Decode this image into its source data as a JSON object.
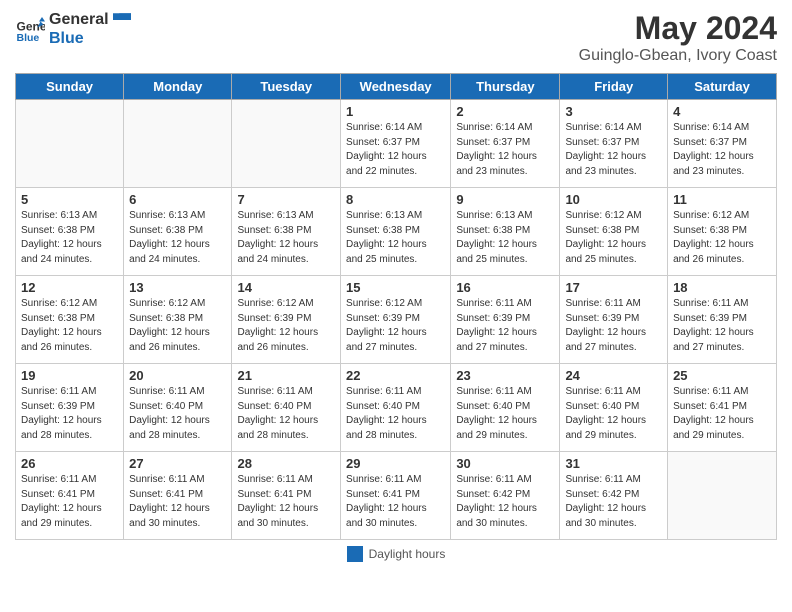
{
  "header": {
    "logo_line1": "General",
    "logo_line2": "Blue",
    "title": "May 2024",
    "subtitle": "Guinglo-Gbean, Ivory Coast"
  },
  "weekdays": [
    "Sunday",
    "Monday",
    "Tuesday",
    "Wednesday",
    "Thursday",
    "Friday",
    "Saturday"
  ],
  "weeks": [
    [
      {
        "day": "",
        "info": ""
      },
      {
        "day": "",
        "info": ""
      },
      {
        "day": "",
        "info": ""
      },
      {
        "day": "1",
        "info": "Sunrise: 6:14 AM\nSunset: 6:37 PM\nDaylight: 12 hours\nand 22 minutes."
      },
      {
        "day": "2",
        "info": "Sunrise: 6:14 AM\nSunset: 6:37 PM\nDaylight: 12 hours\nand 23 minutes."
      },
      {
        "day": "3",
        "info": "Sunrise: 6:14 AM\nSunset: 6:37 PM\nDaylight: 12 hours\nand 23 minutes."
      },
      {
        "day": "4",
        "info": "Sunrise: 6:14 AM\nSunset: 6:37 PM\nDaylight: 12 hours\nand 23 minutes."
      }
    ],
    [
      {
        "day": "5",
        "info": "Sunrise: 6:13 AM\nSunset: 6:38 PM\nDaylight: 12 hours\nand 24 minutes."
      },
      {
        "day": "6",
        "info": "Sunrise: 6:13 AM\nSunset: 6:38 PM\nDaylight: 12 hours\nand 24 minutes."
      },
      {
        "day": "7",
        "info": "Sunrise: 6:13 AM\nSunset: 6:38 PM\nDaylight: 12 hours\nand 24 minutes."
      },
      {
        "day": "8",
        "info": "Sunrise: 6:13 AM\nSunset: 6:38 PM\nDaylight: 12 hours\nand 25 minutes."
      },
      {
        "day": "9",
        "info": "Sunrise: 6:13 AM\nSunset: 6:38 PM\nDaylight: 12 hours\nand 25 minutes."
      },
      {
        "day": "10",
        "info": "Sunrise: 6:12 AM\nSunset: 6:38 PM\nDaylight: 12 hours\nand 25 minutes."
      },
      {
        "day": "11",
        "info": "Sunrise: 6:12 AM\nSunset: 6:38 PM\nDaylight: 12 hours\nand 26 minutes."
      }
    ],
    [
      {
        "day": "12",
        "info": "Sunrise: 6:12 AM\nSunset: 6:38 PM\nDaylight: 12 hours\nand 26 minutes."
      },
      {
        "day": "13",
        "info": "Sunrise: 6:12 AM\nSunset: 6:38 PM\nDaylight: 12 hours\nand 26 minutes."
      },
      {
        "day": "14",
        "info": "Sunrise: 6:12 AM\nSunset: 6:39 PM\nDaylight: 12 hours\nand 26 minutes."
      },
      {
        "day": "15",
        "info": "Sunrise: 6:12 AM\nSunset: 6:39 PM\nDaylight: 12 hours\nand 27 minutes."
      },
      {
        "day": "16",
        "info": "Sunrise: 6:11 AM\nSunset: 6:39 PM\nDaylight: 12 hours\nand 27 minutes."
      },
      {
        "day": "17",
        "info": "Sunrise: 6:11 AM\nSunset: 6:39 PM\nDaylight: 12 hours\nand 27 minutes."
      },
      {
        "day": "18",
        "info": "Sunrise: 6:11 AM\nSunset: 6:39 PM\nDaylight: 12 hours\nand 27 minutes."
      }
    ],
    [
      {
        "day": "19",
        "info": "Sunrise: 6:11 AM\nSunset: 6:39 PM\nDaylight: 12 hours\nand 28 minutes."
      },
      {
        "day": "20",
        "info": "Sunrise: 6:11 AM\nSunset: 6:40 PM\nDaylight: 12 hours\nand 28 minutes."
      },
      {
        "day": "21",
        "info": "Sunrise: 6:11 AM\nSunset: 6:40 PM\nDaylight: 12 hours\nand 28 minutes."
      },
      {
        "day": "22",
        "info": "Sunrise: 6:11 AM\nSunset: 6:40 PM\nDaylight: 12 hours\nand 28 minutes."
      },
      {
        "day": "23",
        "info": "Sunrise: 6:11 AM\nSunset: 6:40 PM\nDaylight: 12 hours\nand 29 minutes."
      },
      {
        "day": "24",
        "info": "Sunrise: 6:11 AM\nSunset: 6:40 PM\nDaylight: 12 hours\nand 29 minutes."
      },
      {
        "day": "25",
        "info": "Sunrise: 6:11 AM\nSunset: 6:41 PM\nDaylight: 12 hours\nand 29 minutes."
      }
    ],
    [
      {
        "day": "26",
        "info": "Sunrise: 6:11 AM\nSunset: 6:41 PM\nDaylight: 12 hours\nand 29 minutes."
      },
      {
        "day": "27",
        "info": "Sunrise: 6:11 AM\nSunset: 6:41 PM\nDaylight: 12 hours\nand 30 minutes."
      },
      {
        "day": "28",
        "info": "Sunrise: 6:11 AM\nSunset: 6:41 PM\nDaylight: 12 hours\nand 30 minutes."
      },
      {
        "day": "29",
        "info": "Sunrise: 6:11 AM\nSunset: 6:41 PM\nDaylight: 12 hours\nand 30 minutes."
      },
      {
        "day": "30",
        "info": "Sunrise: 6:11 AM\nSunset: 6:42 PM\nDaylight: 12 hours\nand 30 minutes."
      },
      {
        "day": "31",
        "info": "Sunrise: 6:11 AM\nSunset: 6:42 PM\nDaylight: 12 hours\nand 30 minutes."
      },
      {
        "day": "",
        "info": ""
      }
    ]
  ],
  "legend": {
    "label": "Daylight hours"
  }
}
